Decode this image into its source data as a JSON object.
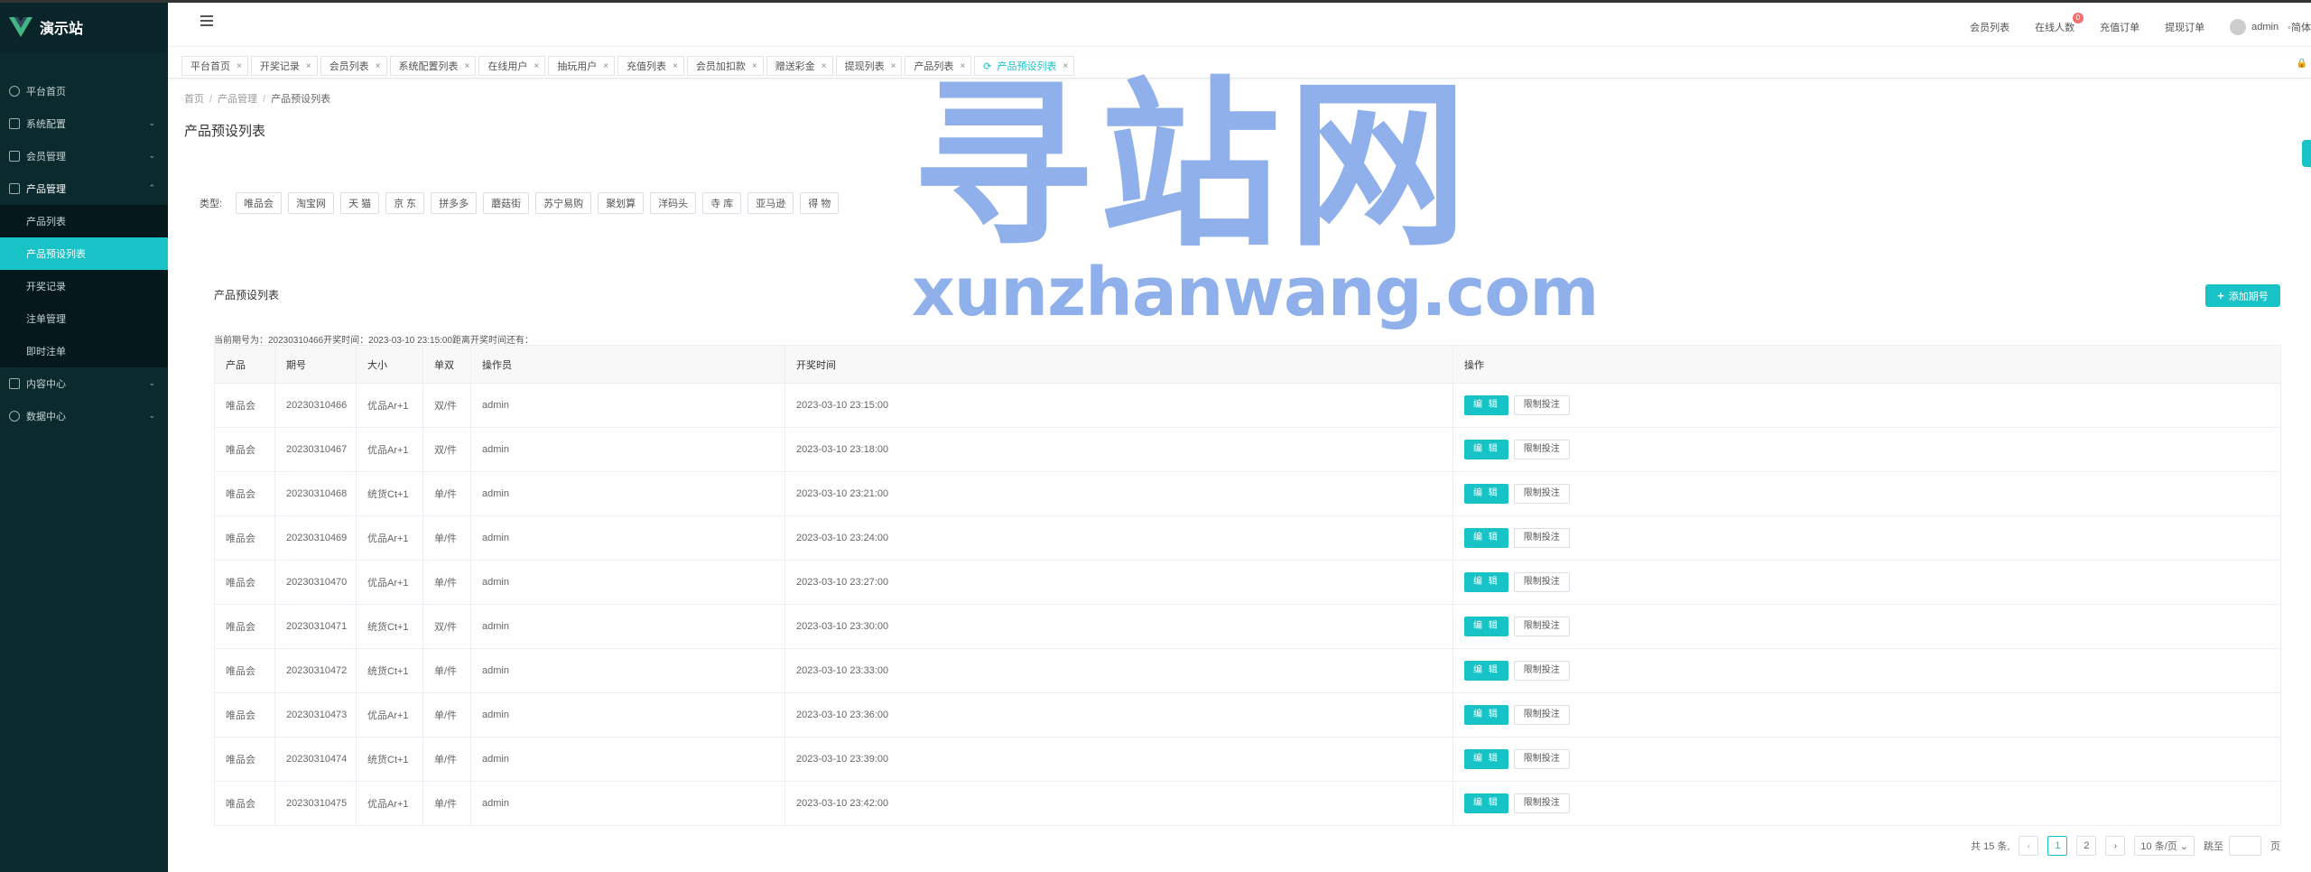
{
  "app": {
    "title": "演示站",
    "brand_color": "#17c3c6",
    "sidebar_bg": "#0b2a2e"
  },
  "sidebar": {
    "items": [
      {
        "label": "平台首页",
        "icon": "dashboard-icon"
      },
      {
        "label": "系统配置",
        "icon": "settings-icon"
      },
      {
        "label": "会员管理",
        "icon": "users-icon"
      },
      {
        "label": "产品管理",
        "icon": "product-icon"
      },
      {
        "label": "内容中心",
        "icon": "content-icon"
      },
      {
        "label": "数据中心",
        "icon": "data-icon"
      }
    ],
    "product_sub": [
      "产品列表",
      "产品预设列表",
      "开奖记录",
      "注单管理",
      "即时注单"
    ]
  },
  "header": {
    "links": [
      "会员列表",
      "在线人数",
      "充值订单",
      "提现订单"
    ],
    "online_badge": "0",
    "user": "admin",
    "lang": "简体"
  },
  "tags": [
    {
      "label": "平台首页"
    },
    {
      "label": "开奖记录"
    },
    {
      "label": "会员列表"
    },
    {
      "label": "系统配置列表"
    },
    {
      "label": "在线用户"
    },
    {
      "label": "抽玩用户"
    },
    {
      "label": "充值列表"
    },
    {
      "label": "会员加扣款"
    },
    {
      "label": "赠送彩金"
    },
    {
      "label": "提现列表"
    },
    {
      "label": "产品列表"
    },
    {
      "label": "产品预设列表"
    }
  ],
  "breadcrumb": [
    "首页",
    "产品管理",
    "产品预设列表"
  ],
  "page_title": "产品预设列表",
  "filter": {
    "label": "类型:",
    "chips": [
      "唯品会",
      "淘宝网",
      "天 猫",
      "京 东",
      "拼多多",
      "蘑菇街",
      "苏宁易购",
      "聚划算",
      "洋码头",
      "寺 库",
      "亚马逊",
      "得 物"
    ]
  },
  "card": {
    "title": "产品预设列表",
    "add_button": "添加期号",
    "current_info": "当前期号为：20230310466开奖时间：2023-03-10 23:15:00距离开奖时间还有："
  },
  "table": {
    "columns": [
      "产品",
      "期号",
      "大小",
      "单双",
      "操作员",
      "开奖时间",
      "操作"
    ],
    "edit_label": "编 辑",
    "limit_label": "限制投注",
    "rows": [
      [
        "唯品会",
        "20230310466",
        "优品Ar+1",
        "双/件",
        "admin",
        "2023-03-10 23:15:00"
      ],
      [
        "唯品会",
        "20230310467",
        "优品Ar+1",
        "双/件",
        "admin",
        "2023-03-10 23:18:00"
      ],
      [
        "唯品会",
        "20230310468",
        "统货Ct+1",
        "单/件",
        "admin",
        "2023-03-10 23:21:00"
      ],
      [
        "唯品会",
        "20230310469",
        "优品Ar+1",
        "单/件",
        "admin",
        "2023-03-10 23:24:00"
      ],
      [
        "唯品会",
        "20230310470",
        "优品Ar+1",
        "单/件",
        "admin",
        "2023-03-10 23:27:00"
      ],
      [
        "唯品会",
        "20230310471",
        "统货Ct+1",
        "双/件",
        "admin",
        "2023-03-10 23:30:00"
      ],
      [
        "唯品会",
        "20230310472",
        "统货Ct+1",
        "单/件",
        "admin",
        "2023-03-10 23:33:00"
      ],
      [
        "唯品会",
        "20230310473",
        "优品Ar+1",
        "单/件",
        "admin",
        "2023-03-10 23:36:00"
      ],
      [
        "唯品会",
        "20230310474",
        "统货Ct+1",
        "单/件",
        "admin",
        "2023-03-10 23:39:00"
      ],
      [
        "唯品会",
        "20230310475",
        "优品Ar+1",
        "单/件",
        "admin",
        "2023-03-10 23:42:00"
      ]
    ]
  },
  "pager": {
    "total": "共 15 条,",
    "pages": [
      "1",
      "2"
    ],
    "page_size": "10 条/页",
    "goto": "跳至",
    "page_unit": "页"
  },
  "watermark": {
    "cn": "寻站网",
    "en": "xunzhanwang.com"
  }
}
